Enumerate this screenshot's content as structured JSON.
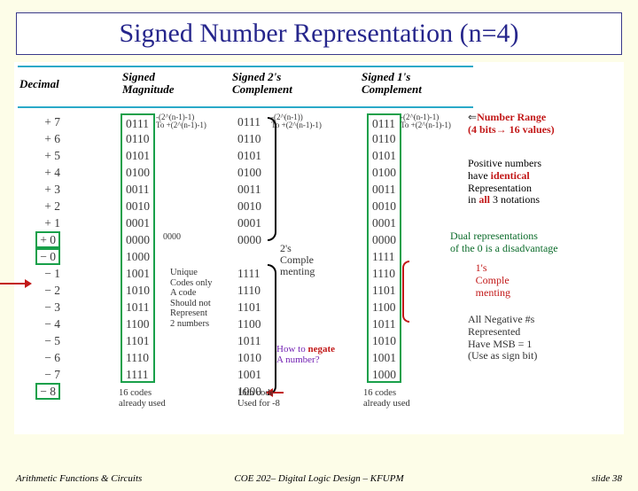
{
  "title": "Signed Number Representation (n=4)",
  "headers": {
    "decimal": "Decimal",
    "signed_mag": "Signed\nMagnitude",
    "signed_2c": "Signed 2's\nComplement",
    "signed_1c": "Signed 1's\nComplement"
  },
  "decimals": [
    "+ 7",
    "+ 6",
    "+ 5",
    "+ 4",
    "+ 3",
    "+ 2",
    "+ 1",
    "+ 0",
    "− 0",
    "− 1",
    "− 2",
    "− 3",
    "− 4",
    "− 5",
    "− 6",
    "− 7",
    "− 8"
  ],
  "signed_magnitude": [
    "0111",
    "0110",
    "0101",
    "0100",
    "0011",
    "0010",
    "0001",
    "0000",
    "1000",
    "1001",
    "1010",
    "1011",
    "1100",
    "1101",
    "1110",
    "1111"
  ],
  "twos_complement": [
    "0111",
    "0110",
    "0101",
    "0100",
    "0011",
    "0010",
    "0001",
    "0000",
    "",
    "1111",
    "1110",
    "1101",
    "1100",
    "1011",
    "1010",
    "1001",
    "1000"
  ],
  "ones_complement": [
    "0111",
    "0110",
    "0101",
    "0100",
    "0011",
    "0010",
    "0001",
    "0000",
    "1111",
    "1110",
    "1101",
    "1100",
    "1011",
    "1010",
    "1001",
    "1000"
  ],
  "range_sm": {
    "line1": "-(2^(n-1)-1)",
    "line2": "To  +(2^(n-1)-1)"
  },
  "range_2c": {
    "line1": "-(2^(n-1))",
    "line2": "To  +(2^(n-1)-1)"
  },
  "range_1c": {
    "line1": "-(2^(n-1)-1)",
    "line2": "To  +(2^(n-1)-1)"
  },
  "sm_zero_label": "0000",
  "annot_number_range": {
    "arrow": "⇐",
    "label": "Number Range",
    "sub": "(4 bits→ 16 values)"
  },
  "annot_positive": {
    "l1": "Positive numbers",
    "l2": "have identical",
    "l3": "Representation",
    "l4": "in all 3 notations"
  },
  "annot_dual": {
    "l1": "Dual representations",
    "l2": "of the 0 is a disadvantage"
  },
  "annot_1s": "1's\nComple\nmenting",
  "annot_2s": "2's\nComple\nmenting",
  "annot_msb": {
    "l1": "All Negative #s",
    "l2": "Represented",
    "l3": "Have MSB = 1",
    "l4": "(Use as sign bit)"
  },
  "note_unique": "Unique\nCodes only\nA code\nShould not\nRepresent\n2 numbers",
  "note_negate": "How to negate\nA number?",
  "note_sm_bottom": "16 codes\nalready used",
  "note_2c_bottom": "16th code\nUsed for -8",
  "note_1c_bottom": "16 codes\nalready used",
  "footer": {
    "left": "Arithmetic Functions & Circuits",
    "center": "COE 202– Digital Logic Design – KFUPM",
    "right": "slide 38"
  }
}
